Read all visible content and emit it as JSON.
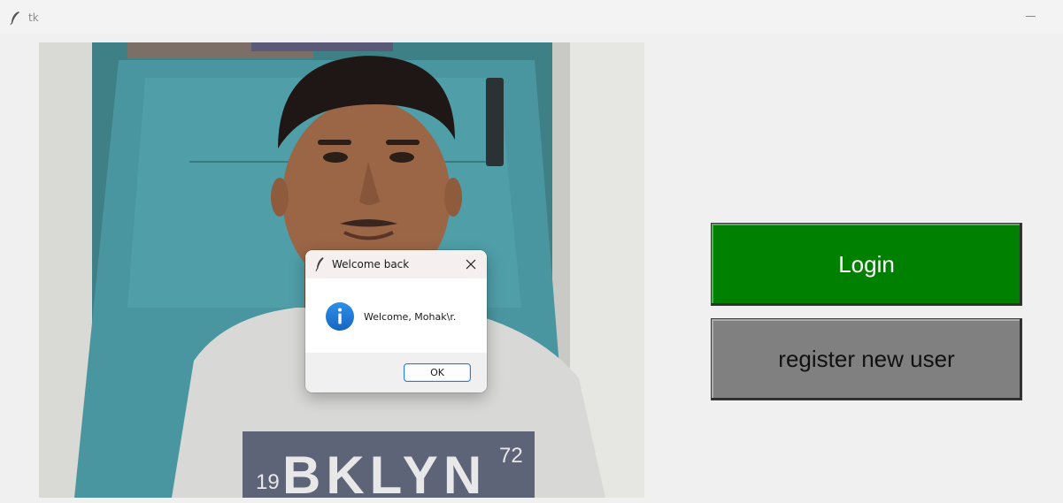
{
  "window": {
    "title": "tk"
  },
  "buttons": {
    "login_label": "Login",
    "register_label": "register new user",
    "login_color": "#008000",
    "register_color": "#808080"
  },
  "dialog": {
    "title": "Welcome back",
    "message": "Welcome, Mohak\\r.",
    "ok_label": "OK",
    "icon": "info-icon"
  },
  "webcam": {
    "shirt_text": "BKLYN",
    "shirt_number_left": "19",
    "shirt_number_right": "72"
  }
}
